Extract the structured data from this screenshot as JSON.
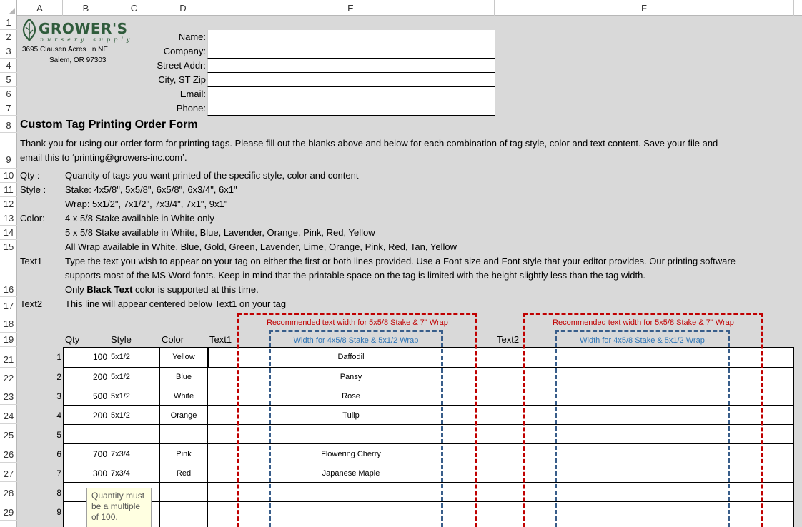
{
  "columns": [
    "A",
    "B",
    "C",
    "D",
    "E",
    "F"
  ],
  "rows": [
    "1",
    "2",
    "3",
    "4",
    "5",
    "6",
    "7",
    "8",
    "9",
    "10",
    "11",
    "12",
    "13",
    "14",
    "15",
    "16",
    "17",
    "18",
    "19",
    "21",
    "22",
    "23",
    "24",
    "25",
    "26",
    "27",
    "28",
    "29"
  ],
  "logo": {
    "name": "GROWER'S",
    "tagline": "nursery supply",
    "color": "#2f5b3b"
  },
  "address": {
    "line1": "3695 Clausen Acres Ln NE",
    "line2": "Salem, OR 97303"
  },
  "contact_fields": [
    "Name:",
    "Company:",
    "Street Addr:",
    "City, ST  Zip",
    "Email:",
    "Phone:"
  ],
  "title": "Custom Tag Printing Order Form",
  "intro": {
    "line1": "Thank you for using our order form for printing tags.  Please fill out the blanks above and below for each combination of tag style, color and text content.  Save your file and",
    "line2": "email this to ‘printing@growers-inc.com’."
  },
  "instructions": {
    "qty_label": "Qty :",
    "qty_text": "Quantity of tags you want printed of the specific style, color and content",
    "style_label": "Style :",
    "style_text1": "Stake: 4x5/8\", 5x5/8\", 6x5/8\", 6x3/4\", 6x1\"",
    "style_text2": "Wrap: 5x1/2\", 7x1/2\", 7x3/4\", 7x1\", 9x1\"",
    "color_label": "Color:",
    "color_text1": "4 x 5/8 Stake available in White only",
    "color_text2": "5 x 5/8 Stake available in White, Blue, Lavender, Orange, Pink, Red, Yellow",
    "color_text3": "All Wrap available in White, Blue, Gold, Green, Lavender, Lime, Orange, Pink, Red, Tan, Yellow",
    "text1_label": "Text1",
    "text1_line1": "Type the text you wish to appear on your tag on either the first or both lines provided.  Use a Font size and Font style that your editor provides.  Our printing software",
    "text1_line2": "supports most of the MS Word fonts.  Keep in mind that the printable space on the tag is limited with the height slightly less than the tag width.",
    "text1_line3a": "Only ",
    "text1_line3b": "Black Text",
    "text1_line3c": " color is supported at this time.",
    "text2_label": "Text2",
    "text2_text": "This line will appear centered below Text1 on your tag"
  },
  "guides": {
    "red": "Recommended text width for 5x5/8 Stake & 7\" Wrap",
    "blue": "Width for 4x5/8 Stake & 5x1/2 Wrap",
    "red_color": "#c00000",
    "blue_color": "#2e75b6"
  },
  "table": {
    "headers": {
      "qty": "Qty",
      "style": "Style",
      "color": "Color",
      "text1": "Text1",
      "text2": "Text2"
    },
    "rows": [
      {
        "n": "1",
        "qty": "100",
        "style": "5x1/2",
        "color": "Yellow",
        "text1": "Daffodil"
      },
      {
        "n": "2",
        "qty": "200",
        "style": "5x1/2",
        "color": "Blue",
        "text1": "Pansy"
      },
      {
        "n": "3",
        "qty": "500",
        "style": "5x1/2",
        "color": "White",
        "text1": "Rose"
      },
      {
        "n": "4",
        "qty": "200",
        "style": "5x1/2",
        "color": "Orange",
        "text1": "Tulip"
      },
      {
        "n": "5",
        "qty": "",
        "style": "",
        "color": "",
        "text1": ""
      },
      {
        "n": "6",
        "qty": "700",
        "style": "7x3/4",
        "color": "Pink",
        "text1": "Flowering Cherry"
      },
      {
        "n": "7",
        "qty": "300",
        "style": "7x3/4",
        "color": "Red",
        "text1": "Japanese Maple"
      },
      {
        "n": "8",
        "qty": "",
        "style": "",
        "color": "",
        "text1": ""
      },
      {
        "n": "9",
        "qty": "",
        "style": "",
        "color": "",
        "text1": ""
      }
    ]
  },
  "tooltip": {
    "line1": "Quantity must",
    "line2": "be a multiple",
    "line3": "of 100."
  }
}
